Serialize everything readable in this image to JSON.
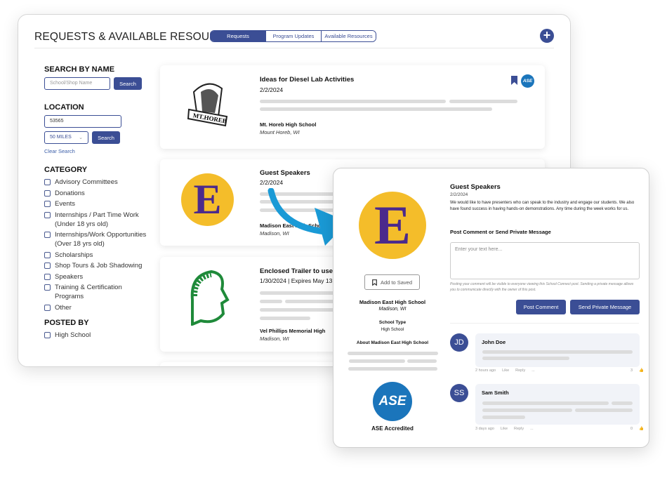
{
  "header": {
    "title": "REQUESTS & AVAILABLE RESOURCES",
    "tabs": [
      {
        "label": "Requests",
        "active": true
      },
      {
        "label": "Program Updates"
      },
      {
        "label": "Available Resources"
      }
    ],
    "add_icon": "plus-circle-icon"
  },
  "sidebar": {
    "search_by_name": {
      "heading": "SEARCH BY NAME",
      "placeholder": "School/Shop Name",
      "button": "Search"
    },
    "location": {
      "heading": "LOCATION",
      "value": "53565",
      "radius": "50 MILES",
      "button": "Search",
      "clear": "Clear Search"
    },
    "category": {
      "heading": "CATEGORY",
      "items": [
        "Advisory Committees",
        "Donations",
        "Events",
        "Internships / Part Time Work (Under 18 yrs old)",
        "Internships/Work Opportunities (Over 18 yrs old)",
        "Scholarships",
        "Shop Tours & Job Shadowing",
        "Speakers",
        "Training & Certification Programs",
        "Other"
      ]
    },
    "posted_by": {
      "heading": "POSTED BY",
      "items": [
        "High School"
      ]
    }
  },
  "posts": [
    {
      "title": "Ideas for Diesel Lab Activities",
      "date": "2/2/2024",
      "school": "Mt. Horeb High School",
      "location": "Mount Horeb, WI",
      "logo_text": "MT. HOREB"
    },
    {
      "title": "Guest Speakers",
      "date": "2/2/2024",
      "school": "Madison East High School",
      "location": "Madison, WI",
      "logo_text": "E"
    },
    {
      "title": "Enclosed Trailer to use",
      "date": "1/30/2024 | Expires May 13",
      "school": "Vel Phillips Memorial High",
      "location": "Madison, WI"
    }
  ],
  "detail": {
    "title": "Guest Speakers",
    "date": "2/2/2024",
    "body": "We would like to have presenters who can speak to the industry and engage our students. We also have found success in having hands-on demonstrations. Any time during the week works for us.",
    "save": "Add to Saved",
    "school": "Madison East High School",
    "location": "Madison, WI",
    "type_label": "School Type",
    "type": "High School",
    "about": "About Madison East High School",
    "badge": "ASE Accredited",
    "badge_logo": "ASE",
    "comment_heading": "Post Comment or Send Private Message",
    "placeholder": "Enter your text here...",
    "note": "Posting your comment will be visible to everyone viewing this School Connect post. Sending a private message allows you to communicate directly with the owner of this post.",
    "post_button": "Post Comment",
    "message_button": "Send Private Message",
    "comments": [
      {
        "initials": "JD",
        "name": "John Doe",
        "time": "2 hours ago",
        "like": "Like",
        "reply": "Reply",
        "more": "...",
        "likes": "3"
      },
      {
        "initials": "SS",
        "name": "Sam Smith",
        "time": "3 days ago",
        "like": "Like",
        "reply": "Reply",
        "more": "...",
        "likes": "0"
      }
    ]
  },
  "colors": {
    "primary": "#3b4e95",
    "arrow": "#1a9ad6",
    "gold": "#f4bd2a",
    "purple": "#4b2a8c",
    "ase": "#1b75bb",
    "green": "#1f8a3a"
  }
}
